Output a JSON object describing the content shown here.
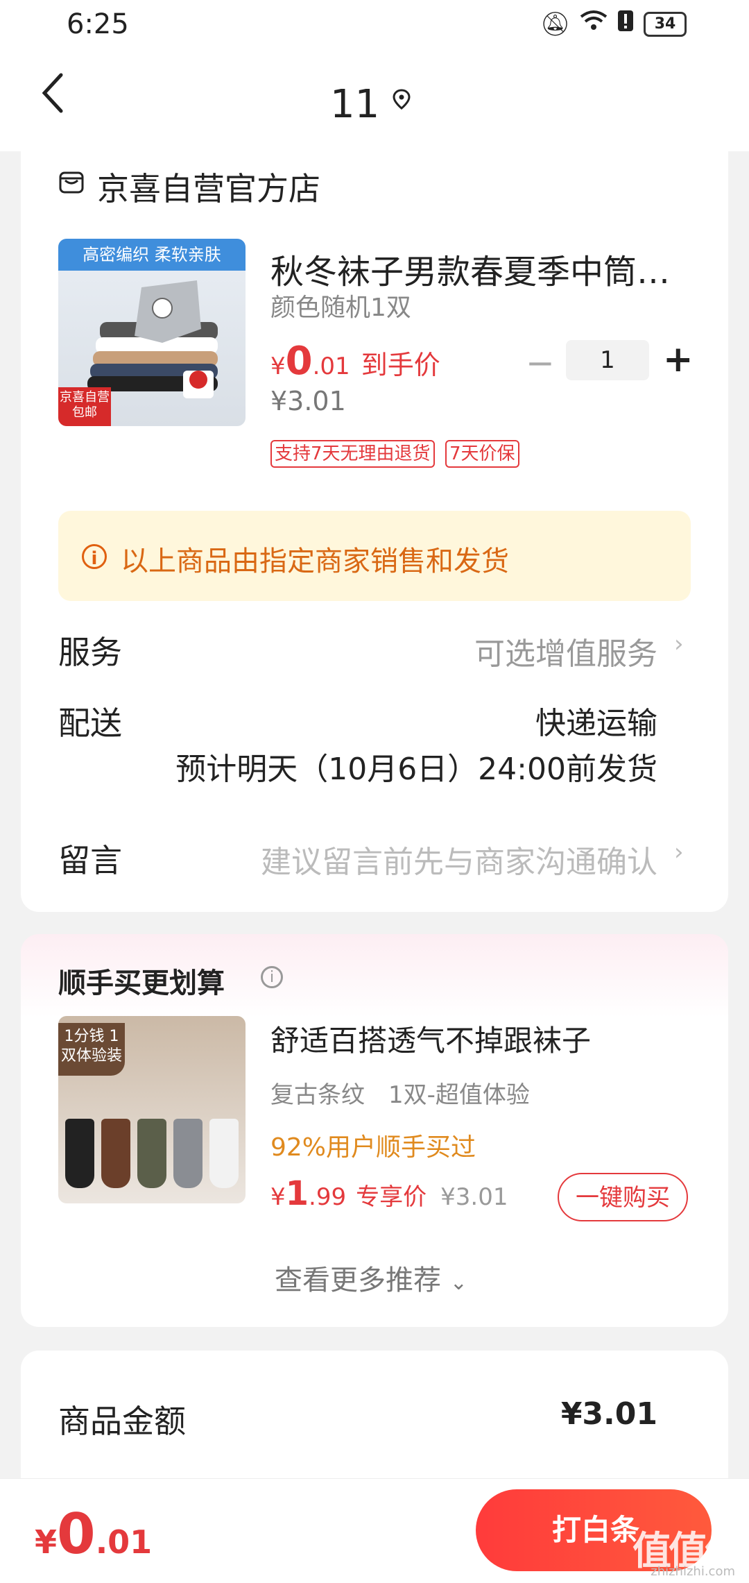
{
  "status_bar": {
    "time": "6:25",
    "battery": "34"
  },
  "header": {
    "title": "11"
  },
  "shop": {
    "name": "京喜自营官方店"
  },
  "product": {
    "image_banner": "高密编织 柔软亲肤",
    "image_tag": "京喜自营 包邮",
    "title": "秋冬袜子男款春夏季中筒…",
    "spec": "颜色随机1双",
    "price_symbol": "¥",
    "price_int": "0",
    "price_dec": ".01",
    "price_label": "到手价",
    "original_price": "¥3.01",
    "quantity": "1",
    "minus": "−",
    "plus": "+",
    "tags": [
      "支持7天无理由退货",
      "7天价保"
    ]
  },
  "notice": {
    "text": "以上商品由指定商家销售和发货"
  },
  "rows": {
    "service_label": "服务",
    "service_value": "可选增值服务",
    "delivery_label": "配送",
    "delivery_method": "快递运输",
    "delivery_time": "预计明天（10月6日）24:00前发货",
    "message_label": "留言",
    "message_placeholder": "建议留言前先与商家沟通确认"
  },
  "recommend": {
    "title": "顺手买更划算",
    "image_badge": "1分钱 1双体验装",
    "item_title": "舒适百搭透气不掉跟袜子",
    "item_spec": "复古条纹　1双-超值体验",
    "buy_rate": "92%用户顺手买过",
    "price_symbol": "¥",
    "price_int": "1",
    "price_dec": ".99",
    "price_label": "专享价",
    "original_price": "¥3.01",
    "buy_button": "一键购买",
    "more": "查看更多推荐"
  },
  "summary": {
    "label": "商品金额",
    "value": "¥3.01"
  },
  "bottom": {
    "total_symbol": "¥",
    "total_int": "0",
    "total_dec": ".01",
    "pay_button": "打白条",
    "watermark": "值值值",
    "watermark_sub": "zhizhizhi.com"
  },
  "colors": {
    "accent": "#e4393c",
    "notice_bg": "#fff7dc",
    "notice_text": "#d96814",
    "highlight": "#e08a1e"
  }
}
